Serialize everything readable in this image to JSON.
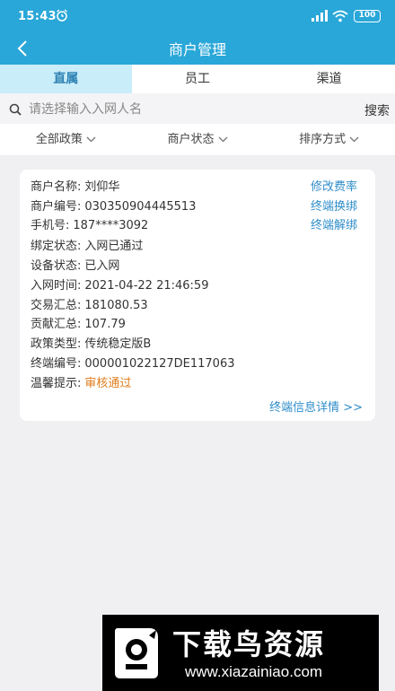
{
  "status_bar": {
    "time": "15:43",
    "battery": "100"
  },
  "nav": {
    "title": "商户管理"
  },
  "tabs": [
    {
      "label": "直属",
      "active": true
    },
    {
      "label": "员工",
      "active": false
    },
    {
      "label": "渠道",
      "active": false
    }
  ],
  "search": {
    "placeholder": "请选择输入入网人名",
    "button": "搜索"
  },
  "filters": [
    {
      "label": "全部政策"
    },
    {
      "label": "商户状态"
    },
    {
      "label": "排序方式"
    }
  ],
  "merchant": {
    "fields": [
      {
        "label": "商户名称:",
        "value": "刘仰华"
      },
      {
        "label": "商户编号:",
        "value": "030350904445513"
      },
      {
        "label": "手机号:",
        "value": "187****3092"
      },
      {
        "label": "绑定状态:",
        "value": "入网已通过"
      },
      {
        "label": "设备状态:",
        "value": "已入网"
      },
      {
        "label": "入网时间:",
        "value": "2021-04-22 21:46:59"
      },
      {
        "label": "交易汇总:",
        "value": "181080.53"
      },
      {
        "label": "贡献汇总:",
        "value": "107.79"
      },
      {
        "label": "政策类型:",
        "value": "传统稳定版B"
      },
      {
        "label": "终端编号:",
        "value": "000001022127DE117063"
      },
      {
        "label": "温馨提示:",
        "value": "审核通过"
      }
    ],
    "actions": [
      "修改费率",
      "终端换绑",
      "终端解绑"
    ],
    "details_link": "终端信息详情 >>"
  },
  "banner": {
    "name": "下载鸟资源",
    "url": "www.xiazainiao.com"
  },
  "colors": {
    "header": "#29a7d8",
    "tab_active_bg": "#c9edf9",
    "link": "#2f8dc9",
    "notice": "#e07d1c",
    "background": "#f0f0f3"
  }
}
